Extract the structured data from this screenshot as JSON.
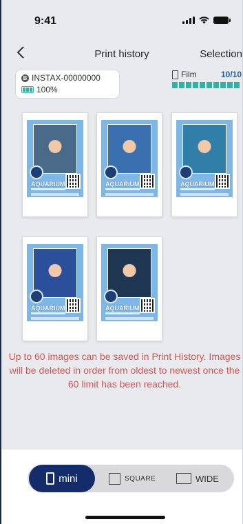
{
  "status_bar": {
    "time": "9:41"
  },
  "nav": {
    "back_icon": "chevron-left",
    "title": "Print history",
    "action": "Selection"
  },
  "device": {
    "name": "INSTAX-00000000",
    "battery": "100%"
  },
  "film": {
    "label": "Film",
    "count": "10/10",
    "remaining_fraction": 1.0
  },
  "prints": [
    {
      "aquarium": "AQUARIUM",
      "photo_bg": "#4a6a8a"
    },
    {
      "aquarium": "AQUARIUM",
      "photo_bg": "#3a6fb0"
    },
    {
      "aquarium": "AQUARIUM",
      "photo_bg": "#2f7fa8"
    },
    {
      "aquarium": "AQUARIUM",
      "photo_bg": "#2c4f9c"
    },
    {
      "aquarium": "AQUARIUM",
      "photo_bg": "#1f3652"
    }
  ],
  "notice": "Up to 60 images can be saved in Print History. Images will be deleted in order from oldest to newest once the 60 limit has been reached.",
  "formats": {
    "mini": "mini",
    "square": "SQUARE",
    "wide": "WIDE",
    "selected": "mini"
  },
  "colors": {
    "accent": "#152c6b",
    "film_bar": "#2bb4a8",
    "notice": "#d9534f"
  }
}
